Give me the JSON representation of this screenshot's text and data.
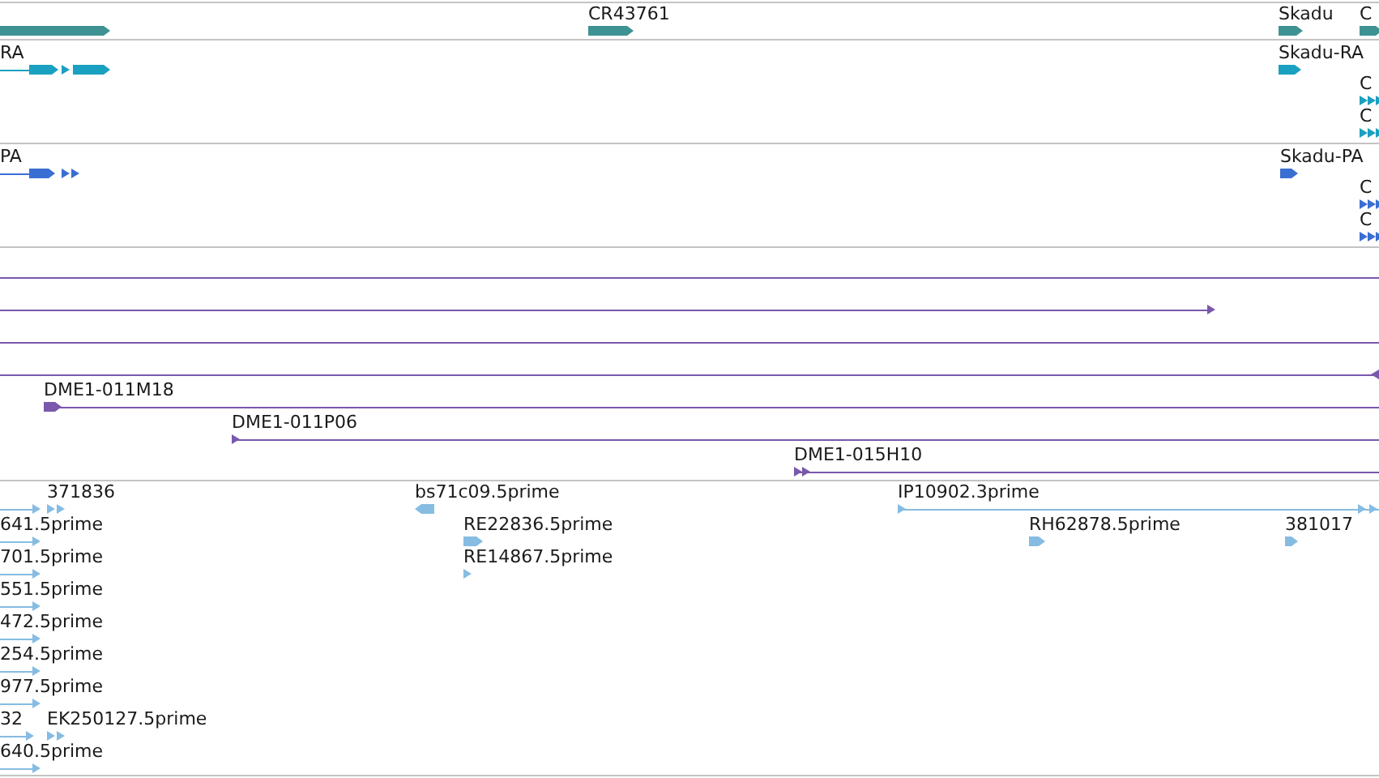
{
  "tracks": [
    {
      "kind": "gene",
      "features": [
        {
          "reverse": false
        },
        {
          "label": "CR43761",
          "reverse": false
        },
        {
          "label": "Skadu",
          "reverse": false
        },
        {
          "label": "C",
          "reverse": false
        }
      ]
    },
    {
      "kind": "transcript",
      "features": [
        {
          "label": "RA",
          "reverse": false
        },
        {
          "label": "Skadu-RA",
          "reverse": false
        },
        {
          "label": "C",
          "reverse": false
        },
        {
          "label": "C",
          "reverse": false
        }
      ]
    },
    {
      "kind": "protein",
      "features": [
        {
          "label": "PA",
          "reverse": false
        },
        {
          "label": "Skadu-PA",
          "reverse": false
        },
        {
          "label": "C",
          "reverse": false
        },
        {
          "label": "C",
          "reverse": false
        }
      ]
    },
    {
      "kind": "clone",
      "features": [
        {
          "kind": "span"
        },
        {
          "kind": "arrow",
          "reverse": false
        },
        {
          "kind": "span"
        },
        {
          "kind": "arrow",
          "reverse": true
        },
        {
          "kind": "arrow",
          "label": "DME1-011M18",
          "reverse": false
        },
        {
          "kind": "arrow",
          "label": "DME1-011P06",
          "reverse": false
        },
        {
          "kind": "arrow",
          "label": "DME1-015H10",
          "reverse": false
        }
      ]
    },
    {
      "kind": "est",
      "features": [
        {
          "reverse": false
        },
        {
          "label": "371836",
          "reverse": false
        },
        {
          "label": "bs71c09.5prime",
          "reverse": true
        },
        {
          "label": "IP10902.3prime",
          "reverse": false
        },
        {
          "label": "641.5prime",
          "reverse": false
        },
        {
          "label": "RE22836.5prime",
          "reverse": false
        },
        {
          "label": "RH62878.5prime",
          "reverse": false
        },
        {
          "label": "381017",
          "reverse": false
        },
        {
          "label": "701.5prime",
          "reverse": false
        },
        {
          "label": "RE14867.5prime",
          "reverse": false
        },
        {
          "label": "551.5prime",
          "reverse": false
        },
        {
          "label": "472.5prime",
          "reverse": false
        },
        {
          "label": "254.5prime",
          "reverse": false
        },
        {
          "label": "977.5prime",
          "reverse": false
        },
        {
          "label": "32",
          "reverse": false
        },
        {
          "label": "EK250127.5prime",
          "reverse": false
        },
        {
          "label": "640.5prime",
          "reverse": false
        }
      ]
    }
  ]
}
